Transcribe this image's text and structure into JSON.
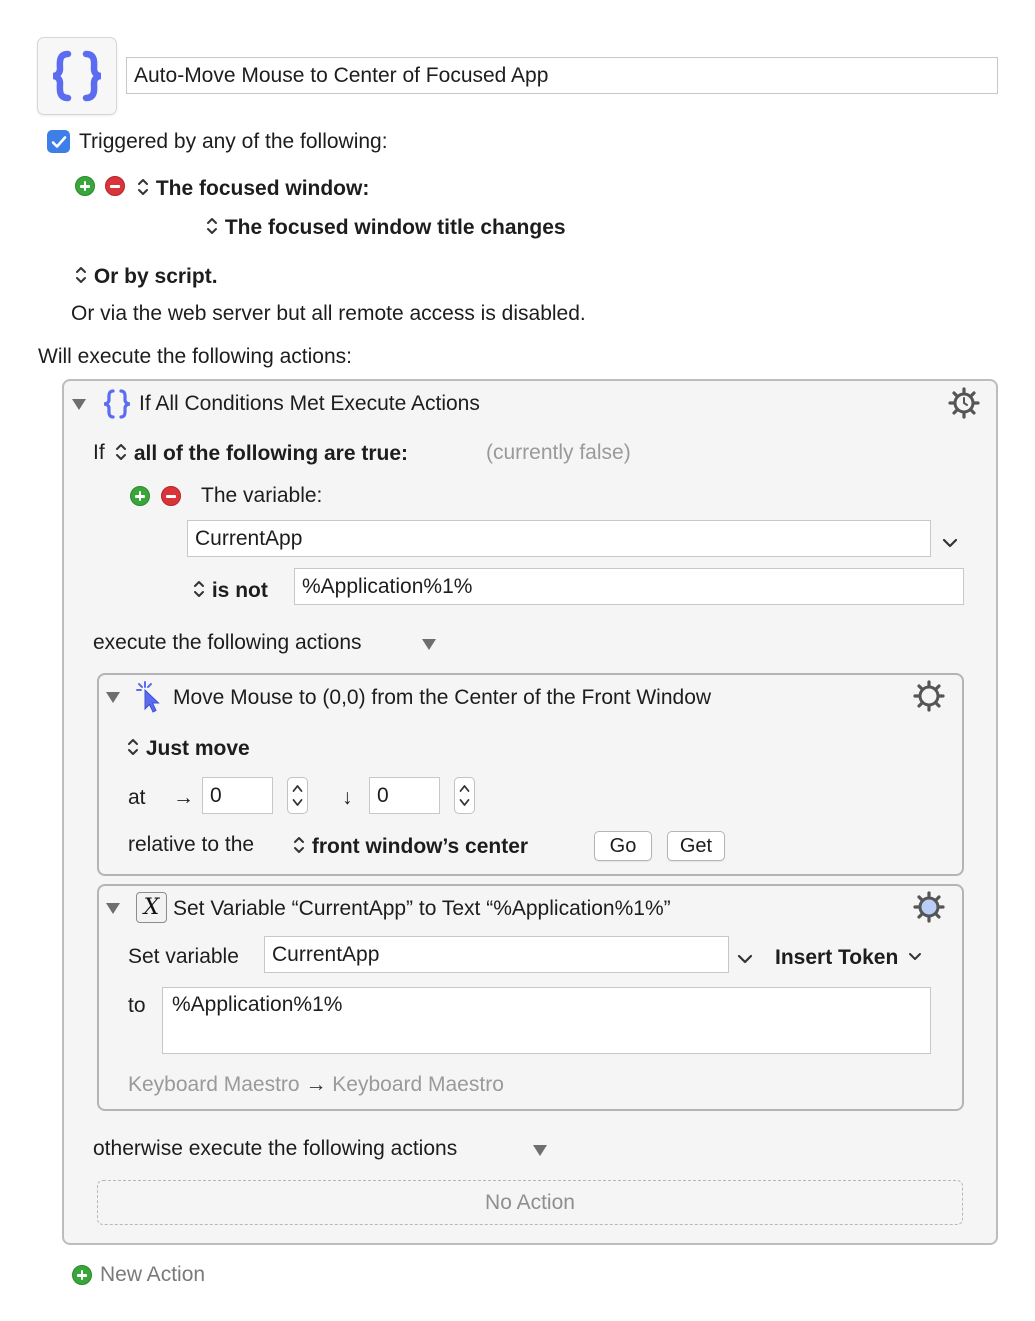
{
  "macro": {
    "icon": "curly-braces-icon",
    "name": "Auto-Move Mouse to Center of Focused App"
  },
  "triggers": {
    "enabled": true,
    "label": "Triggered by any of the following:",
    "trigger_type": "The focused window:",
    "trigger_condition": "The focused window title changes",
    "or_by_script": "Or by script.",
    "web_server_note": "Or via the web server but all remote access is disabled."
  },
  "actions_header": "Will execute the following actions:",
  "if_action": {
    "title": "If All Conditions Met Execute Actions",
    "if_label": "If",
    "condition_mode": "all of the following are true:",
    "status": "(currently false)",
    "condition": {
      "label": "The variable:",
      "variable": "CurrentApp",
      "operator": "is not",
      "value": "%Application%1%"
    },
    "then_label": "execute the following actions",
    "otherwise_label": "otherwise execute the following actions",
    "no_action": "No Action"
  },
  "move_mouse": {
    "title": "Move Mouse to (0,0) from the Center of the Front Window",
    "mode": "Just move",
    "at_label": "at",
    "right_arrow": "→",
    "down_arrow": "↓",
    "x": "0",
    "y": "0",
    "relative_label": "relative to the",
    "relative_to": "front window’s center",
    "go_button": "Go",
    "get_button": "Get"
  },
  "set_variable": {
    "title": "Set Variable “CurrentApp” to Text “%Application%1%”",
    "icon_glyph": "X",
    "set_label": "Set variable",
    "variable": "CurrentApp",
    "insert_token": "Insert Token",
    "to_label": "to",
    "text": "%Application%1%",
    "source_app": "Keyboard Maestro",
    "arrow": "→",
    "target_app": "Keyboard Maestro"
  },
  "new_action": "New Action",
  "colors": {
    "accent_blue": "#3d7fe6",
    "icon_purple": "#5b6cf0",
    "add_green": "#3aa53b",
    "remove_red": "#d9343a"
  }
}
